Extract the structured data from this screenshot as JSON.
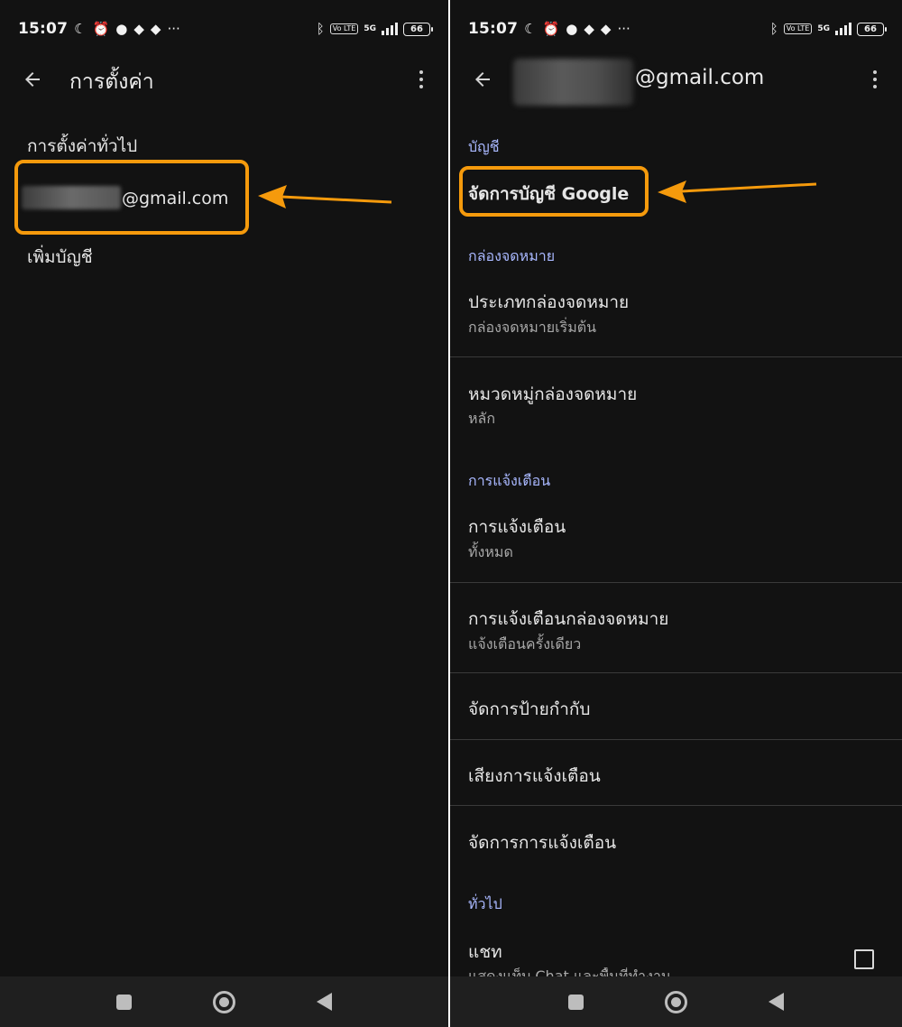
{
  "status_bar": {
    "time": "15:07",
    "network": "5G",
    "volte": "Vo LTE",
    "battery": "66",
    "icons": [
      "moon-icon",
      "alarm-icon",
      "chat-bubble-icon",
      "game-icon",
      "game-icon",
      "more-dots-icon",
      "bluetooth-icon",
      "signal-icon",
      "battery-icon"
    ]
  },
  "left_screen": {
    "title": "การตั้งค่า",
    "items": {
      "general": "การตั้งค่าทั่วไป",
      "account_suffix": "@gmail.com",
      "add_account": "เพิ่มบัญชี"
    }
  },
  "right_screen": {
    "email_suffix": "@gmail.com",
    "sections": {
      "account": "บัญชี",
      "inbox": "กล่องจดหมาย",
      "notifications": "การแจ้งเตือน",
      "general": "ทั่วไป"
    },
    "items": {
      "manage_google": "จัดการบัญชี Google",
      "inbox_type_title": "ประเภทกล่องจดหมาย",
      "inbox_type_sub": "กล่องจดหมายเริ่มต้น",
      "inbox_category_title": "หมวดหมู่กล่องจดหมาย",
      "inbox_category_sub": "หลัก",
      "notifications_title": "การแจ้งเตือน",
      "notifications_sub": "ทั้งหมด",
      "inbox_notif_title": "การแจ้งเตือนกล่องจดหมาย",
      "inbox_notif_sub": "แจ้งเตือนครั้งเดียว",
      "manage_labels": "จัดการป้ายกำกับ",
      "notif_sounds": "เสียงการแจ้งเตือน",
      "manage_notifs": "จัดการการแจ้งเตือน",
      "chat_title": "แชท",
      "chat_sub": "แสดงแท็บ Chat และพื้นที่ทำงาน"
    }
  },
  "colors": {
    "background": "#121212",
    "highlight": "#f59a0c",
    "section_header": "#a9b8ff"
  }
}
